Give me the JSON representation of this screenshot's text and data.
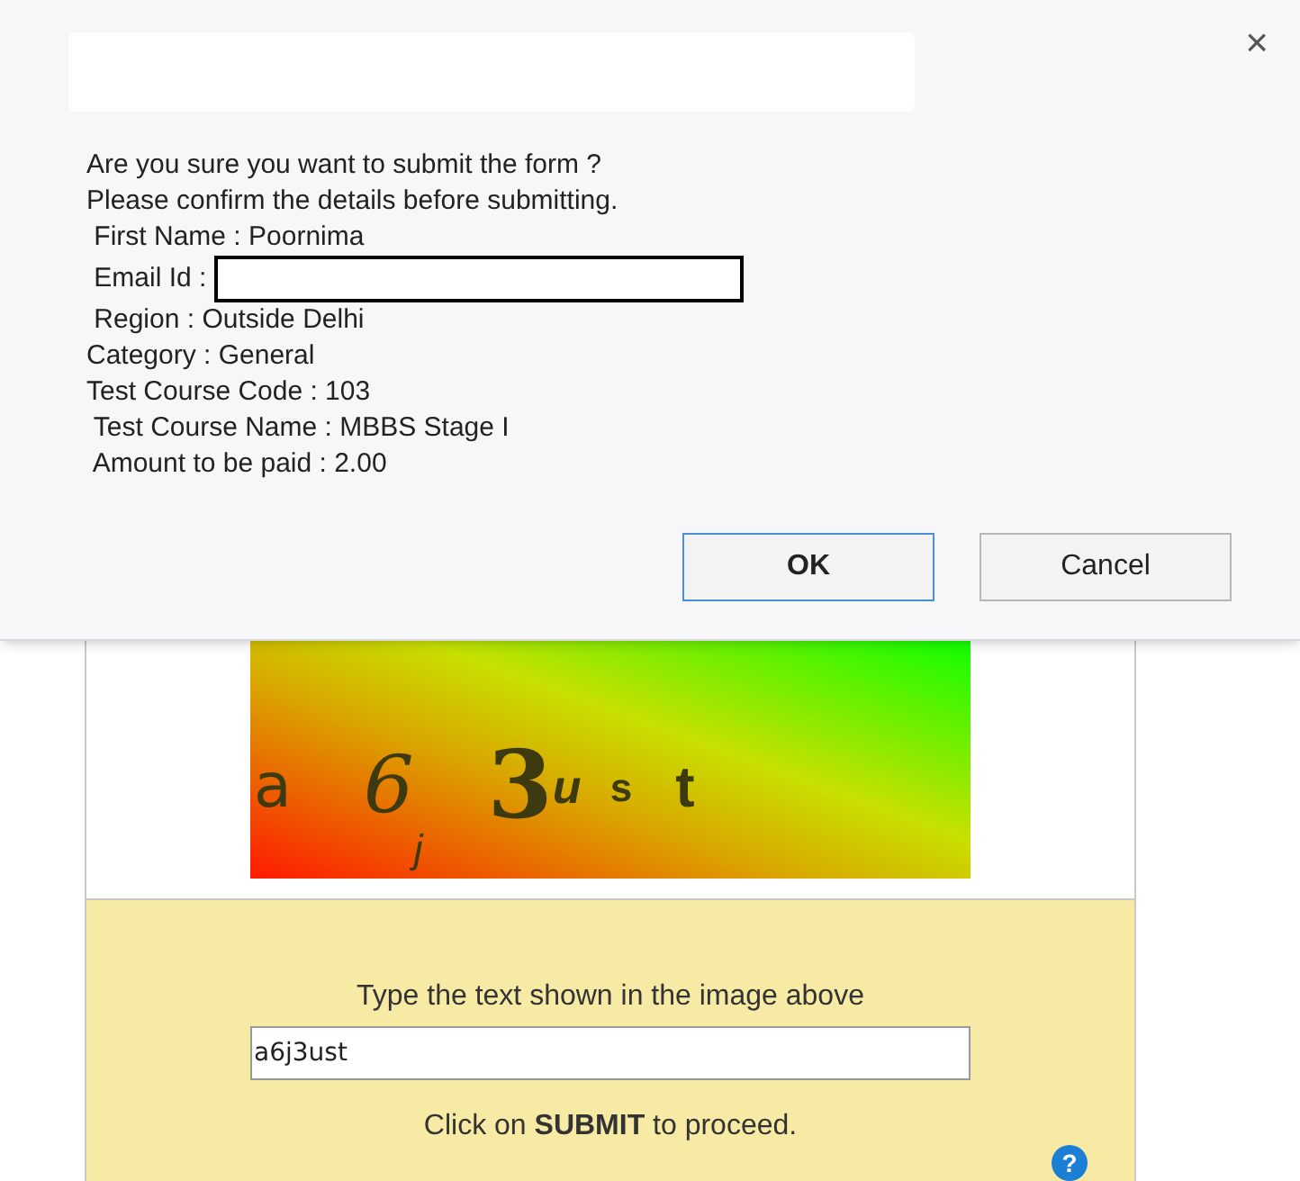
{
  "dialog": {
    "close": "×",
    "lines": [
      {
        "text": "Are you sure you want to submit the form ?"
      },
      {
        "text": "Please confirm the details before submitting."
      },
      {
        "text": " First Name : Poornima"
      },
      {
        "text": " Email Id :",
        "redacted": true
      },
      {
        "text": " Region : Outside Delhi"
      },
      {
        "text": "Category : General"
      },
      {
        "text": "Test Course Code : 103"
      },
      {
        "text": " Test Course Name : MBBS Stage I"
      },
      {
        "text": " Amount to be paid : 2.00"
      }
    ],
    "buttons": [
      {
        "label": "OK",
        "focused": true
      },
      {
        "label": "Cancel",
        "focused": false
      }
    ]
  },
  "captcha": {
    "characters": [
      "a",
      "6",
      "j",
      "3",
      "u",
      "s",
      "t"
    ],
    "prompt": "Type the text shown in the image above",
    "value": "a6j3ust",
    "note": "Click on **SUBMIT** to proceed.",
    "help": "?"
  }
}
